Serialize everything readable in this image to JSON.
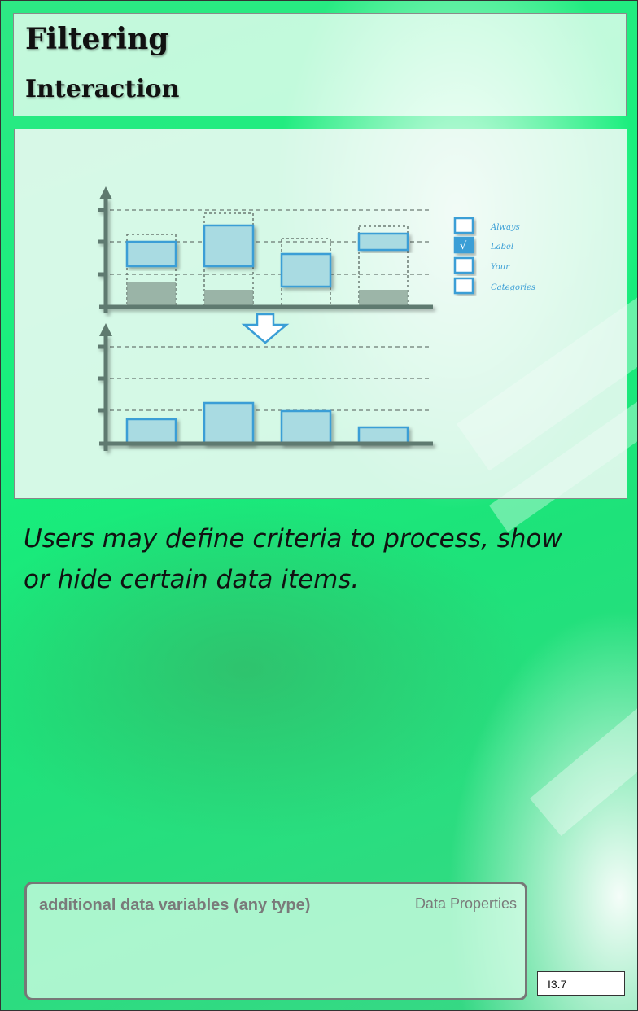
{
  "header": {
    "title": "Filtering",
    "subtitle": "Interaction"
  },
  "illustration": {
    "checkboxes": [
      {
        "label": "Always",
        "checked": false
      },
      {
        "label": "Label",
        "checked": true
      },
      {
        "label": "Your",
        "checked": false
      },
      {
        "label": "Categories",
        "checked": false
      }
    ],
    "check_mark": "√",
    "colors": {
      "bar_fill": "#a9dbe2",
      "bar_stroke": "#3a9ed6",
      "axis": "#5f7a6f",
      "filtered": "#8fa89b",
      "arrow": "#3a9ed6"
    }
  },
  "description": "Users may define criteria to process, show or hide certain data items.",
  "properties": {
    "main_label": "additional data variables (any type)",
    "tag": "Data Properties"
  },
  "code": "I3.7"
}
